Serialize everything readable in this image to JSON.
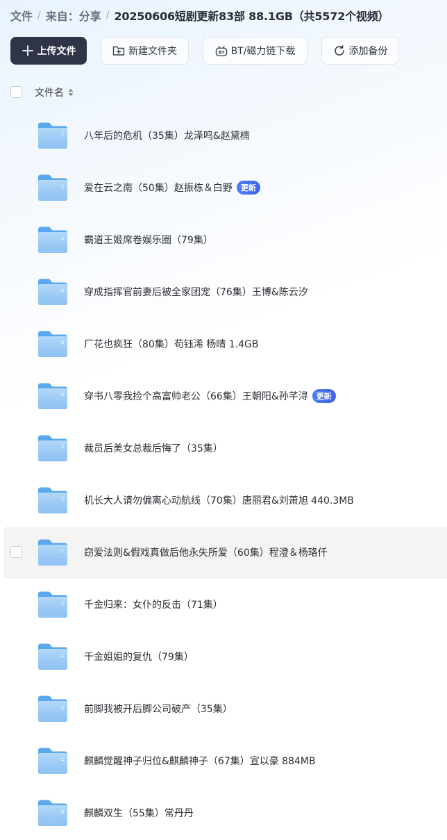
{
  "breadcrumb": {
    "root": "文件",
    "source": "来自：分享",
    "current": "20250606短剧更新83部 88.1GB（共5572个视频）"
  },
  "toolbar": {
    "upload_label": "上传文件",
    "new_folder_label": "新建文件夹",
    "bt_label": "BT/磁力链下载",
    "backup_label": "添加备份"
  },
  "list": {
    "column_name": "文件名"
  },
  "colors": {
    "primary_button": "#2f3547",
    "badge": "#4a72f2",
    "folder": "#8cc3f5"
  },
  "files": [
    {
      "name": "八年后的危机（35集）龙泽鸣&赵黛楠",
      "badge": ""
    },
    {
      "name": "爱在云之南（50集）赵振栋＆白野",
      "badge": "更新"
    },
    {
      "name": "霸道王姬席卷娱乐圈（79集）",
      "badge": ""
    },
    {
      "name": "穿成指挥官前妻后被全家团宠（76集）王博&陈云汐",
      "badge": ""
    },
    {
      "name": "厂花也疯狂（80集）苟钰浠 杨晴 1.4GB",
      "badge": ""
    },
    {
      "name": "穿书八零我捡个高富帅老公（66集）王朝阳&孙芊浔",
      "badge": "更新"
    },
    {
      "name": "裁员后美女总裁后悔了（35集）",
      "badge": ""
    },
    {
      "name": "机长大人请勿偏离心动航线（70集）唐丽君&刘萧旭 440.3MB",
      "badge": ""
    },
    {
      "name": "窃爱法则&假戏真做后他永失所爱（60集）程澄＆杨珞仟",
      "badge": ""
    },
    {
      "name": "千金归来：女仆的反击（71集）",
      "badge": ""
    },
    {
      "name": "千金姐姐的复仇（79集）",
      "badge": ""
    },
    {
      "name": "前脚我被开后脚公司破产（35集）",
      "badge": ""
    },
    {
      "name": "麒麟觉醒神子归位&麒麟神子（67集）宣以豪 884MB",
      "badge": ""
    },
    {
      "name": "麒麟双生（55集）常丹丹",
      "badge": ""
    }
  ]
}
